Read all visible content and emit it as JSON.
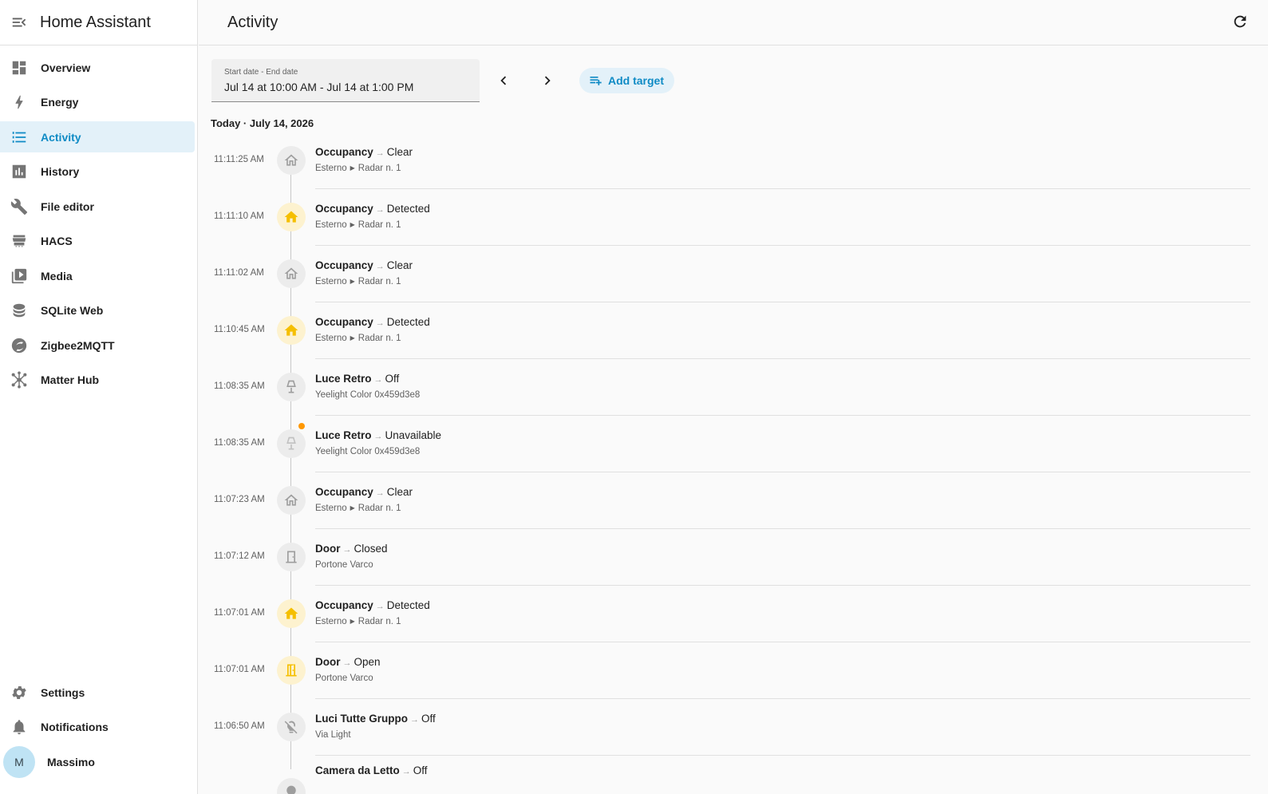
{
  "app": {
    "title": "Home Assistant"
  },
  "sidebar": {
    "items": [
      {
        "label": "Overview",
        "icon": "dashboard-icon",
        "active": false
      },
      {
        "label": "Energy",
        "icon": "lightning-icon",
        "active": false
      },
      {
        "label": "Activity",
        "icon": "list-icon",
        "active": true
      },
      {
        "label": "History",
        "icon": "chart-bar-icon",
        "active": false
      },
      {
        "label": "File editor",
        "icon": "wrench-icon",
        "active": false
      },
      {
        "label": "HACS",
        "icon": "hacs-store-icon",
        "active": false
      },
      {
        "label": "Media",
        "icon": "media-play-icon",
        "active": false
      },
      {
        "label": "SQLite Web",
        "icon": "database-icon",
        "active": false
      },
      {
        "label": "Zigbee2MQTT",
        "icon": "zigbee-icon",
        "active": false
      },
      {
        "label": "Matter Hub",
        "icon": "hub-icon",
        "active": false
      }
    ],
    "bottom": {
      "settings": "Settings",
      "notifications": "Notifications",
      "user_initial": "M",
      "user_name": "Massimo"
    }
  },
  "header": {
    "title": "Activity"
  },
  "filters": {
    "date_label": "Start date - End date",
    "date_value": "Jul 14 at 10:00 AM - Jul 14 at 1:00 PM",
    "add_target": "Add target"
  },
  "day_header": "Today · July 14, 2026",
  "arrow": "→",
  "entries": [
    {
      "time": "11:11:25 AM",
      "name": "Occupancy",
      "state": "Clear",
      "sub": [
        "Esterno",
        "Radar n. 1"
      ],
      "icon": "home-outline-icon",
      "on": false
    },
    {
      "time": "11:11:10 AM",
      "name": "Occupancy",
      "state": "Detected",
      "sub": [
        "Esterno",
        "Radar n. 1"
      ],
      "icon": "home-icon",
      "on": true
    },
    {
      "time": "11:11:02 AM",
      "name": "Occupancy",
      "state": "Clear",
      "sub": [
        "Esterno",
        "Radar n. 1"
      ],
      "icon": "home-outline-icon",
      "on": false
    },
    {
      "time": "11:10:45 AM",
      "name": "Occupancy",
      "state": "Detected",
      "sub": [
        "Esterno",
        "Radar n. 1"
      ],
      "icon": "home-icon",
      "on": true
    },
    {
      "time": "11:08:35 AM",
      "name": "Luce Retro",
      "state": "Off",
      "sub": [
        "Yeelight Color 0x459d3e8"
      ],
      "icon": "lamp-icon",
      "on": false
    },
    {
      "time": "11:08:35 AM",
      "name": "Luce Retro",
      "state": "Unavailable",
      "sub": [
        "Yeelight Color 0x459d3e8"
      ],
      "icon": "lamp-icon",
      "on": false,
      "unavailable": true
    },
    {
      "time": "11:07:23 AM",
      "name": "Occupancy",
      "state": "Clear",
      "sub": [
        "Esterno",
        "Radar n. 1"
      ],
      "icon": "home-outline-icon",
      "on": false
    },
    {
      "time": "11:07:12 AM",
      "name": "Door",
      "state": "Closed",
      "sub": [
        "Portone Varco"
      ],
      "icon": "door-closed-icon",
      "on": false
    },
    {
      "time": "11:07:01 AM",
      "name": "Occupancy",
      "state": "Detected",
      "sub": [
        "Esterno",
        "Radar n. 1"
      ],
      "icon": "home-icon",
      "on": true
    },
    {
      "time": "11:07:01 AM",
      "name": "Door",
      "state": "Open",
      "sub": [
        "Portone Varco"
      ],
      "icon": "door-open-icon",
      "on": true
    },
    {
      "time": "11:06:50 AM",
      "name": "Luci Tutte Gruppo",
      "state": "Off",
      "sub": [
        "Via Light"
      ],
      "icon": "lightbulb-group-off-icon",
      "on": false
    },
    {
      "time": "",
      "name": "Camera da Letto",
      "state": "Off",
      "sub": [],
      "icon": "lightbulb-icon",
      "on": false
    }
  ]
}
